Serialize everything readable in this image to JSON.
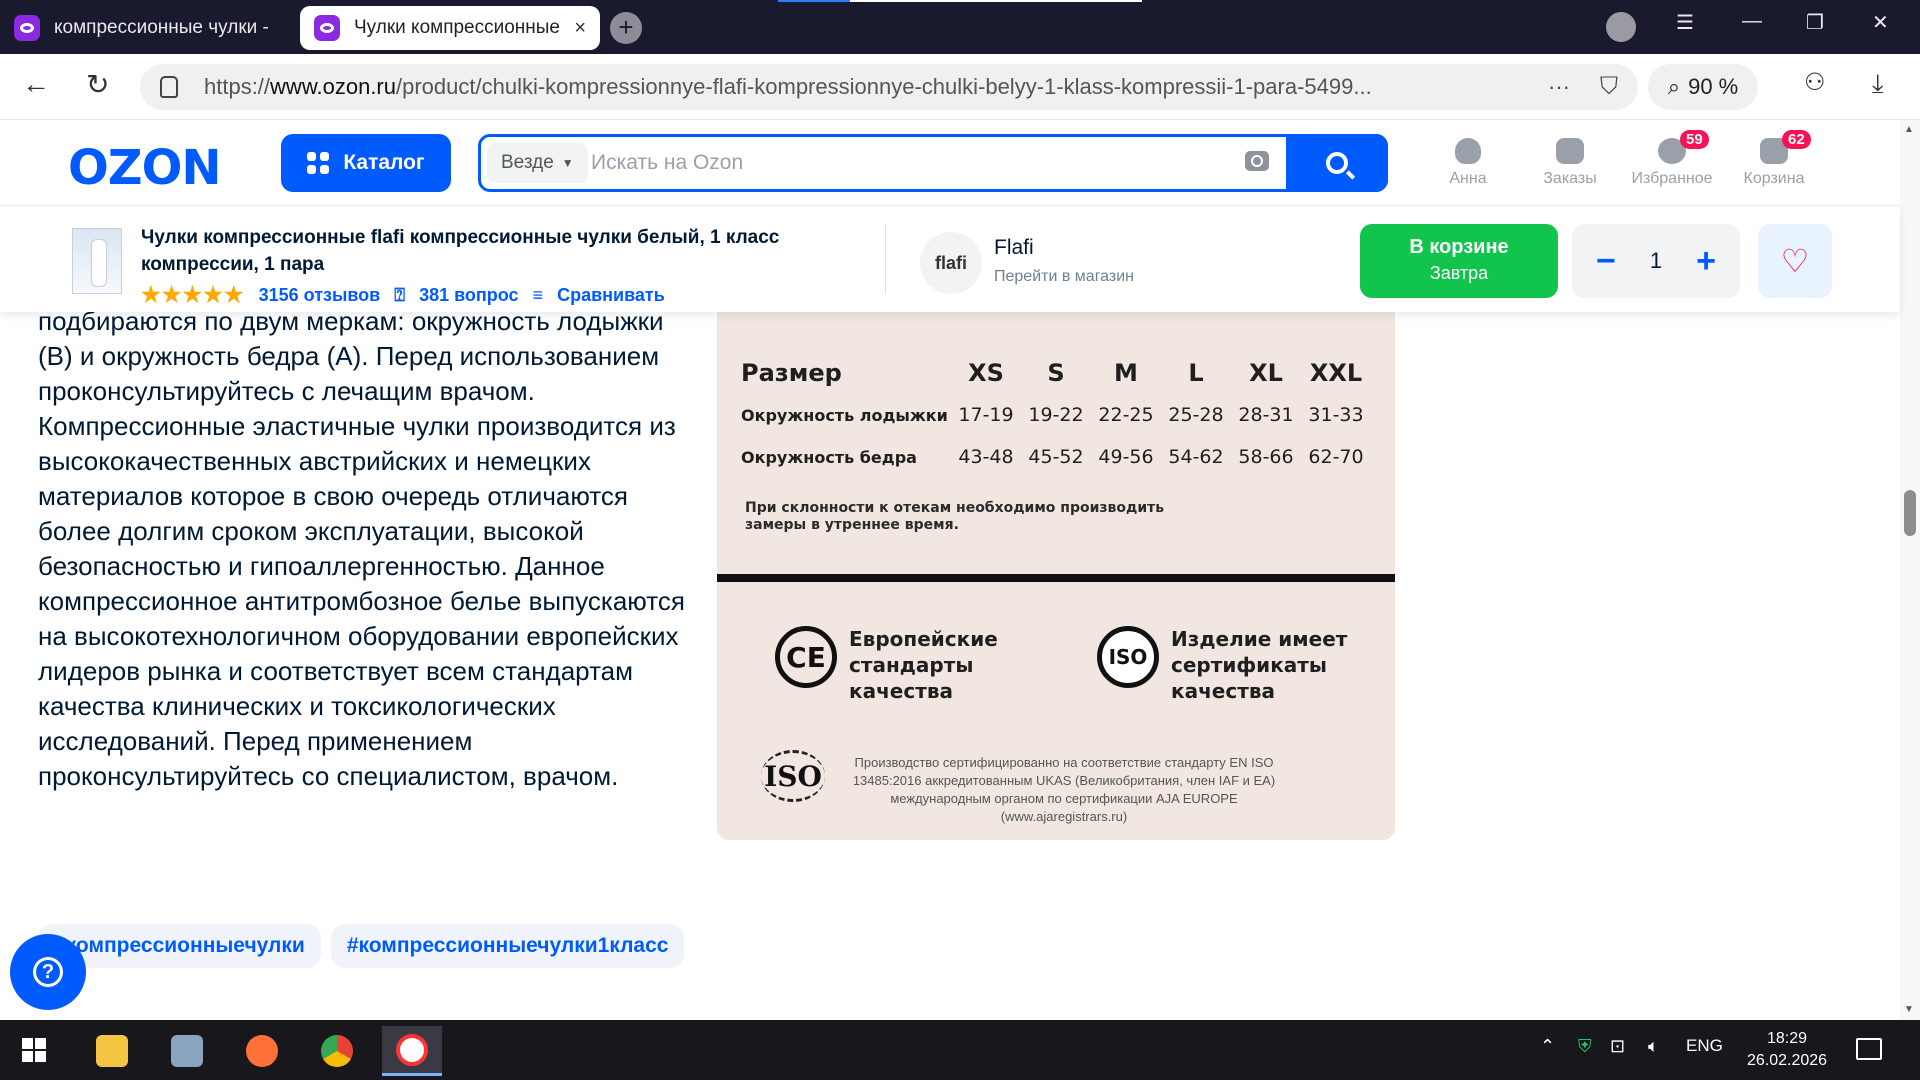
{
  "browser": {
    "tabs": [
      {
        "title": "компрессионные чулки -"
      },
      {
        "title": "Чулки компрессионные",
        "close": "×"
      }
    ],
    "new_tab": "+",
    "url_prefix": "https://",
    "url_domain": "www.ozon.ru",
    "url_path": "/product/chulki-kompressionnye-flafi-kompressionnye-chulki-belyy-1-klass-kompressii-1-para-5499...",
    "url_menu": "···",
    "zoom": "90 %"
  },
  "header": {
    "logo": "OZON",
    "catalog_label": "Каталог",
    "search_scope": "Везде",
    "search_placeholder": "Искать на Ozon",
    "user_label": "Анна",
    "orders_label": "Заказы",
    "favorites_label": "Избранное",
    "favorites_count": "59",
    "cart_label": "Корзина",
    "cart_count": "62"
  },
  "product": {
    "title": "Чулки компрессионные flafi компрессионные чулки белый, 1 класс компрессии, 1 пара",
    "rating_stars": "★★★★★",
    "reviews": "3156 отзывов",
    "questions": "381 вопрос",
    "compare": "Сравнивать",
    "shop_logo_text": "flafi",
    "shop_name": "Flafi",
    "shop_link": "Перейти в магазин",
    "cart_button_line1": "В корзине",
    "cart_button_line2": "Завтра",
    "qty_minus": "−",
    "qty_value": "1",
    "qty_plus": "+",
    "fav_icon": "♡"
  },
  "description": {
    "p1": "подбираются по двум меркам: окружность лодыжки (B) и окружность бедра (A). Перед использованием проконсультируйтесь с лечащим врачом.",
    "p2": "Компрессионные эластичные чулки производится из высококачественных австрийских и немецких материалов которое в свою очередь отличаются более долгим сроком эксплуатации, высокой безопасностью и гипоаллергенностью. Данное компрессионное антитромбозное белье выпускаются на высокотехнологичном оборудовании европейских лидеров рынка и соответствует всем стандартам качества клинических и токсикологических исследований. Перед применением проконсультируйтесь со специалистом, врачом."
  },
  "size_chart": {
    "header": [
      "Размер",
      "XS",
      "S",
      "M",
      "L",
      "XL",
      "XXL"
    ],
    "row1": [
      "Окружность лодыжки",
      "17-19",
      "19-22",
      "22-25",
      "25-28",
      "28-31",
      "31-33"
    ],
    "row2": [
      "Окружность бедра",
      "43-48",
      "45-52",
      "49-56",
      "54-62",
      "58-66",
      "62-70"
    ],
    "note": "При склонности к отекам необходимо производить замеры в утреннее время.",
    "ce_mark": "CE",
    "ce_text": "Европейские стандарты качества",
    "iso_mark": "ISO",
    "iso_text": "Изделие имеет сертификаты качества",
    "iso_mark2": "ISO",
    "iso_footer": "Производство сертифицированно на соответствие стандарту EN ISO 13485:2016 аккредитованным UKAS (Великобритания, член IAF и EA) международным органом по сертификации AJA EUROPE (www.ajaregistrars.ru)"
  },
  "tags": [
    "#компрессионныечулки",
    "#компрессионныечулки1класс"
  ],
  "help_icon": "?",
  "taskbar": {
    "lang": "ENG",
    "time": "18:29",
    "date": "26.02.2026"
  }
}
